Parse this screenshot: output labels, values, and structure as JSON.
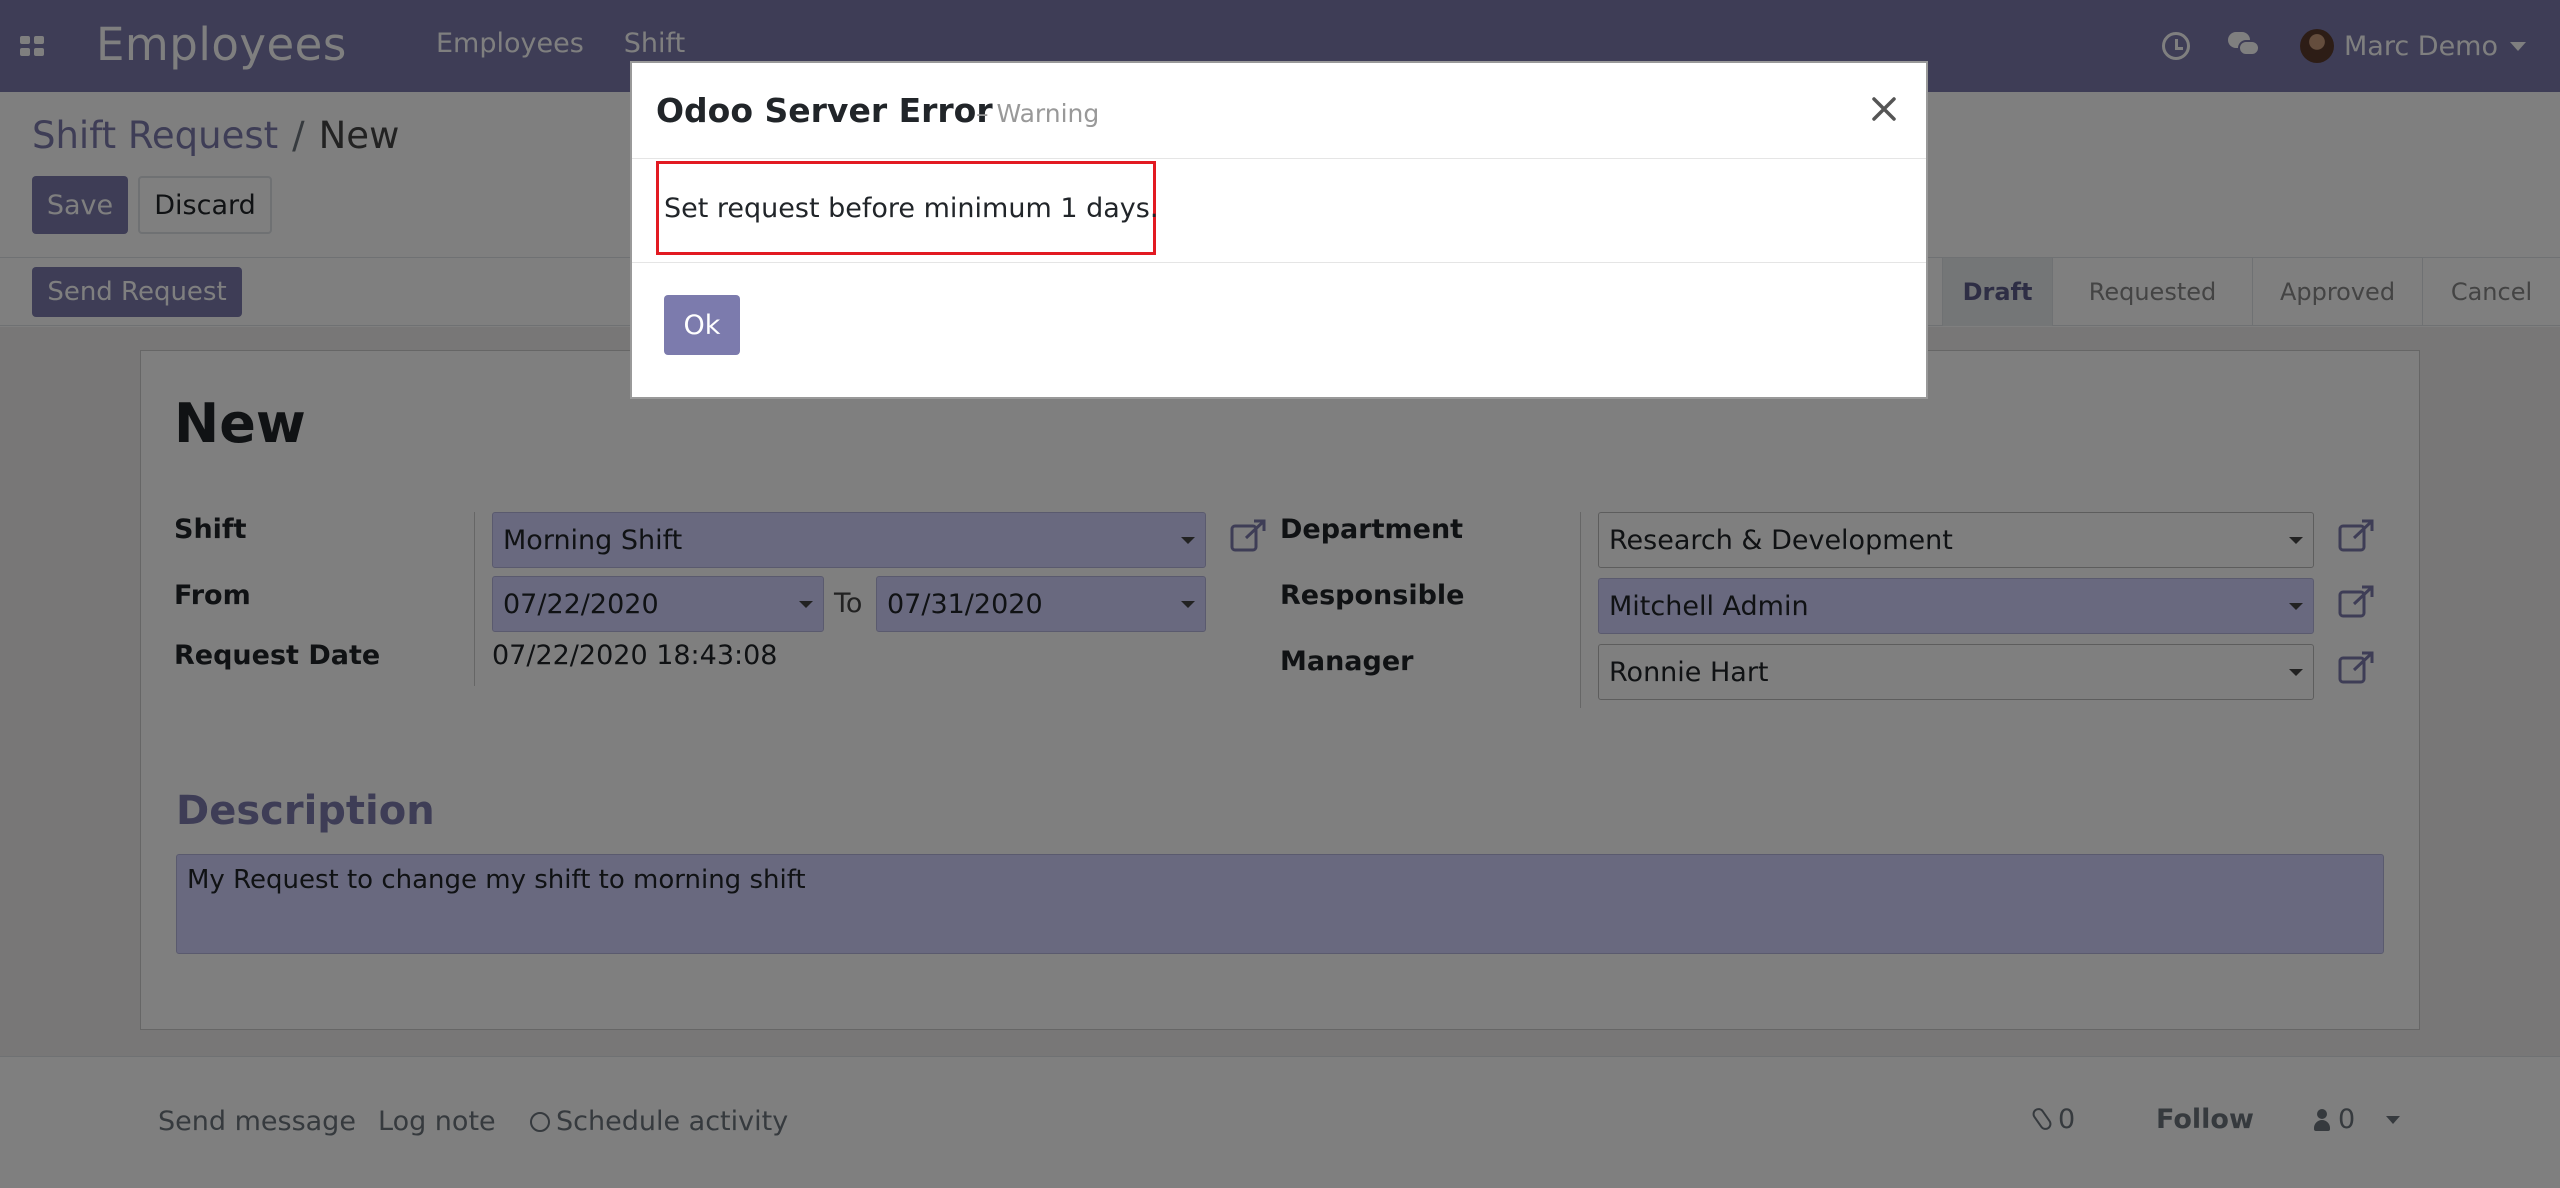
{
  "navbar": {
    "app_name": "Employees",
    "menu": [
      "Employees",
      "Shift"
    ],
    "user_name": "Marc Demo",
    "icons": [
      "apps-icon",
      "clock-icon",
      "chat-icon",
      "avatar"
    ]
  },
  "breadcrumb": {
    "parent": "Shift Request",
    "separator": "/",
    "current": "New"
  },
  "buttons": {
    "save": "Save",
    "discard": "Discard",
    "send_request": "Send Request"
  },
  "stages": [
    {
      "label": "Draft",
      "active": true
    },
    {
      "label": "Requested",
      "active": false
    },
    {
      "label": "Approved",
      "active": false
    },
    {
      "label": "Cancel",
      "active": false
    }
  ],
  "form": {
    "title": "New",
    "shift": {
      "label": "Shift",
      "value": "Morning Shift"
    },
    "from": {
      "label": "From",
      "value": "07/22/2020",
      "to_label": "To",
      "to_value": "07/31/2020"
    },
    "request_date": {
      "label": "Request Date",
      "value": "07/22/2020 18:43:08"
    },
    "department": {
      "label": "Department",
      "value": "Research & Development"
    },
    "responsible": {
      "label": "Responsible",
      "value": "Mitchell Admin"
    },
    "manager": {
      "label": "Manager",
      "value": "Ronnie Hart"
    },
    "description": {
      "title": "Description",
      "value": "My Request to change my shift to morning shift"
    }
  },
  "chatter": {
    "send_message": "Send message",
    "log_note": "Log note",
    "schedule_activity": "Schedule activity",
    "attachments": "0",
    "follow": "Follow",
    "followers": "0"
  },
  "modal": {
    "title": "Odoo Server Error",
    "subtitle": "– Warning",
    "message": "Set request before minimum 1 days.",
    "ok": "Ok"
  },
  "colors": {
    "primary": "#7c7bad",
    "required_field": "#d2d2ff",
    "highlight": "#e21a22"
  }
}
